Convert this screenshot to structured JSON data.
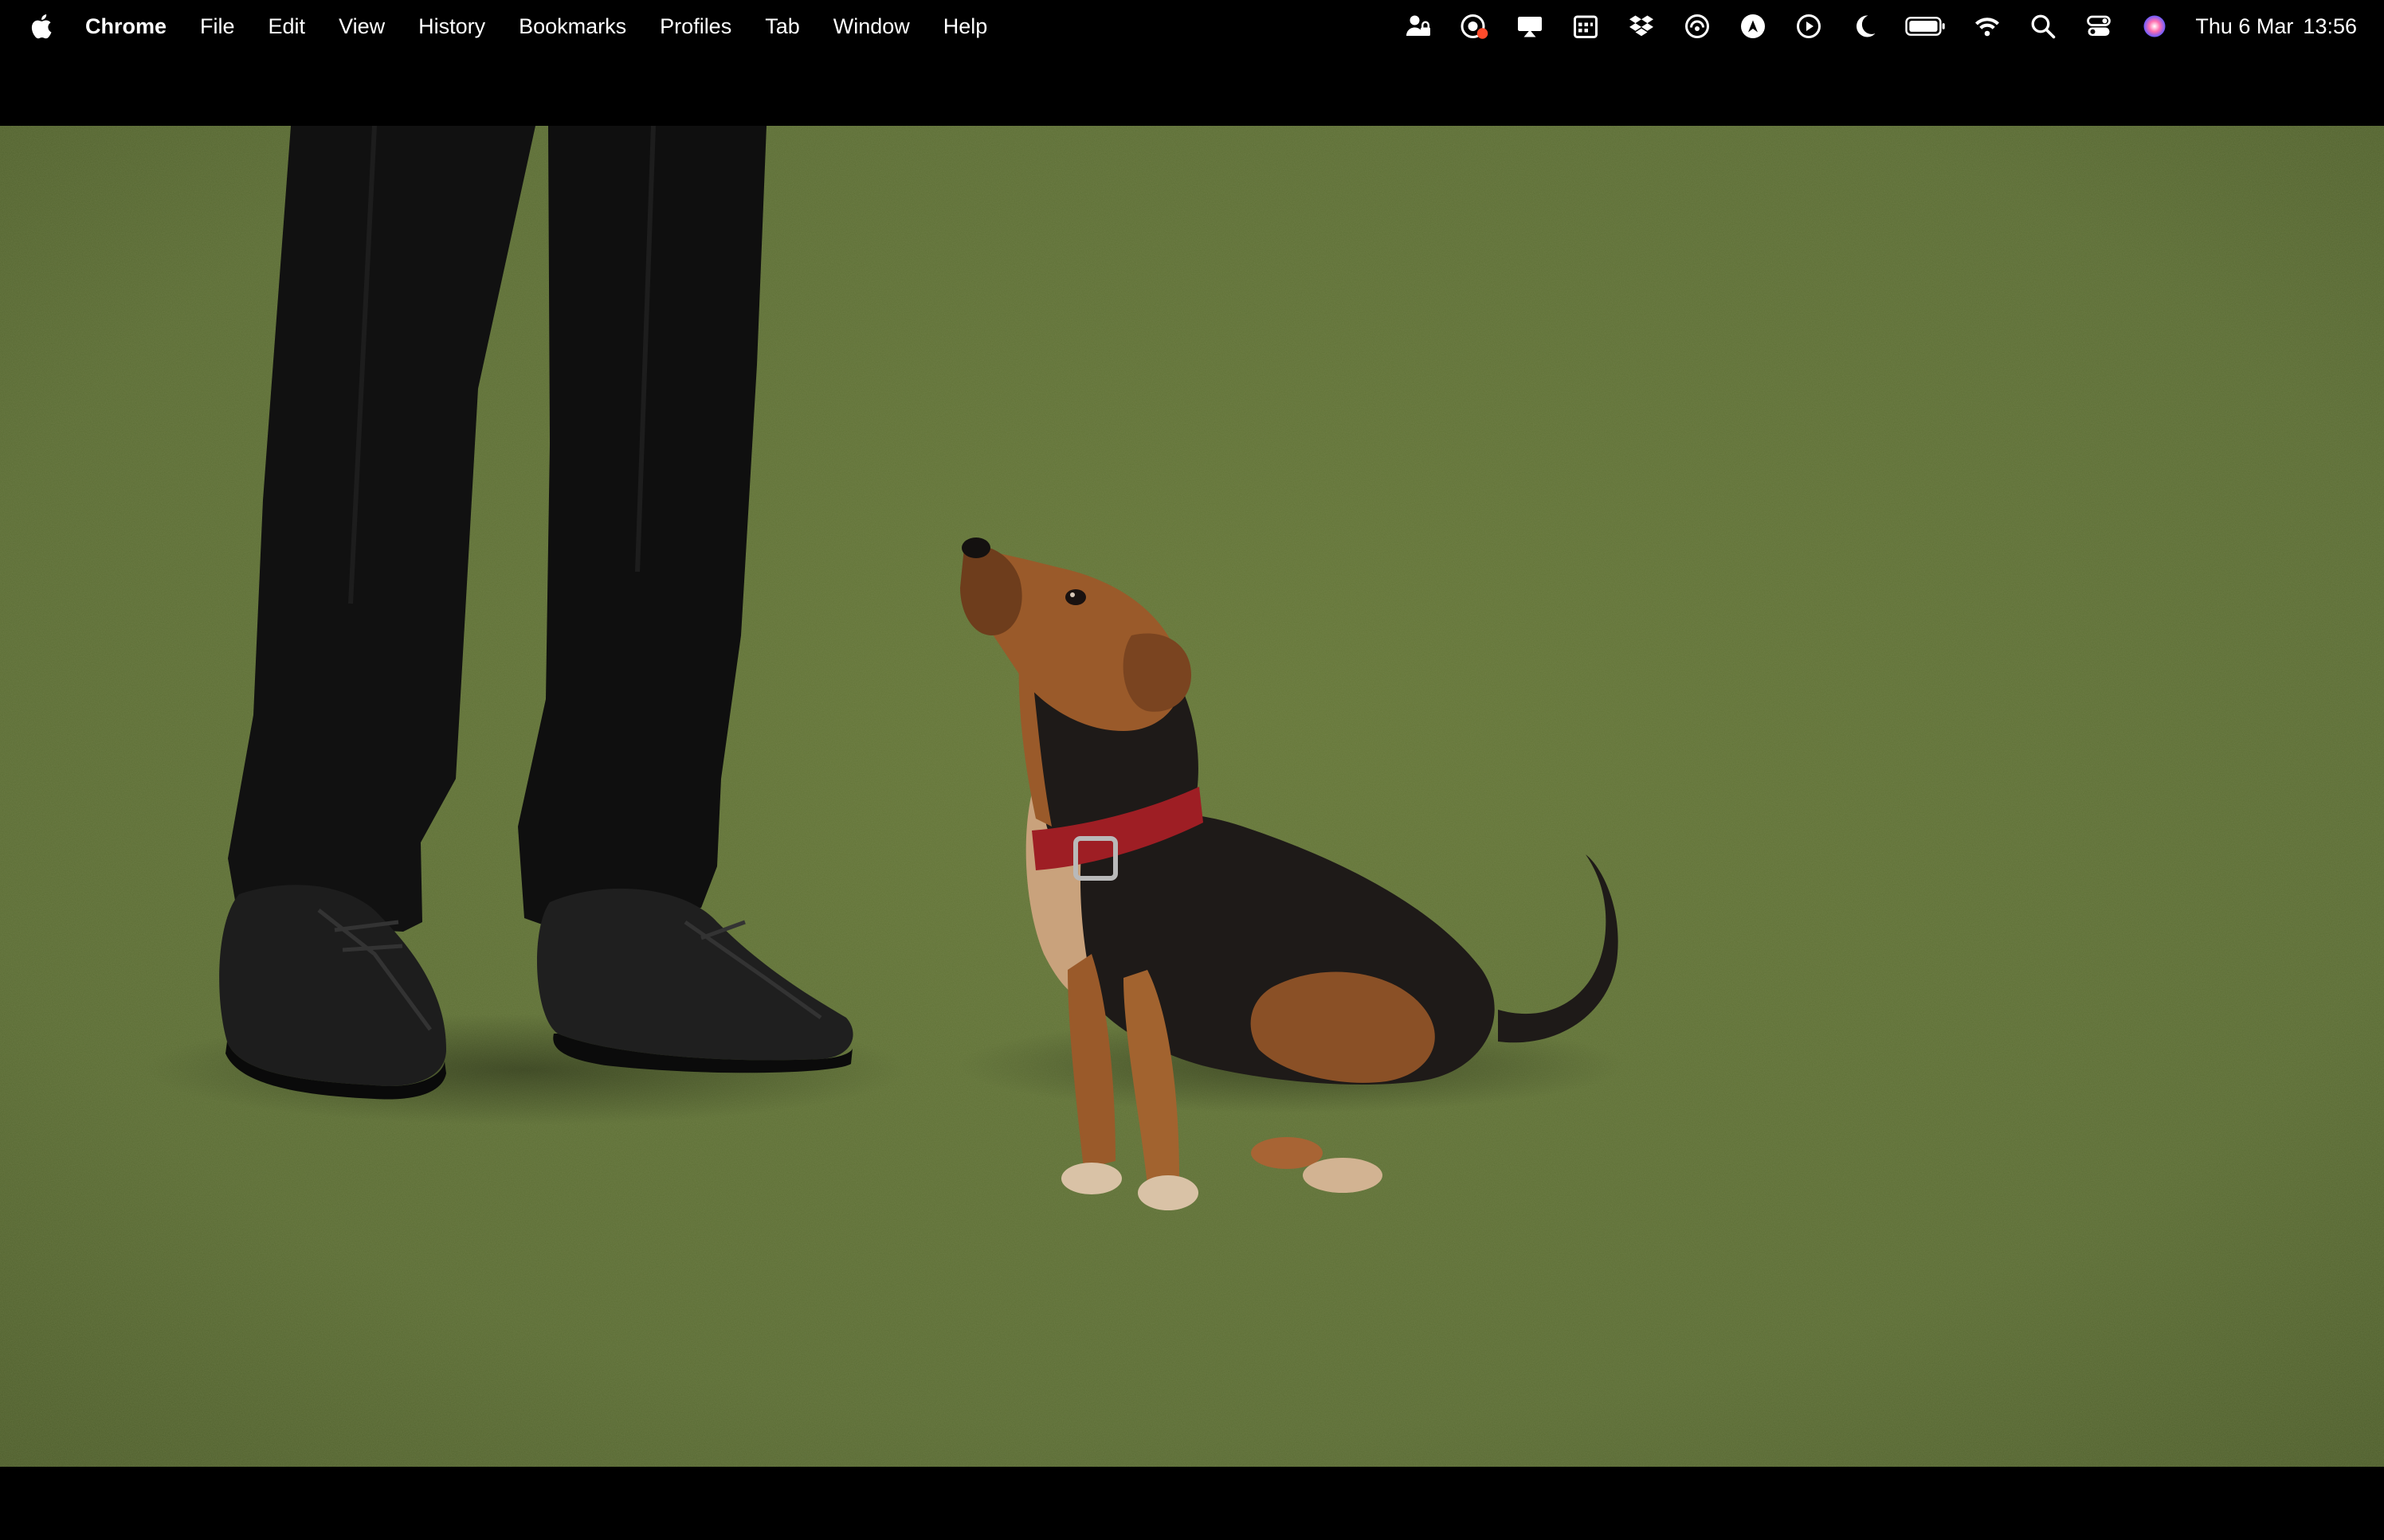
{
  "menubar": {
    "apple_icon": "apple-logo-icon",
    "app_name": "Chrome",
    "menus": [
      "File",
      "Edit",
      "View",
      "History",
      "Bookmarks",
      "Profiles",
      "Tab",
      "Window",
      "Help"
    ],
    "status_icons": [
      "lock-person-icon",
      "screen-recorder-icon",
      "airplay-display-icon",
      "calendar-grid-icon",
      "dropbox-icon",
      "edge-swirl-icon",
      "vpn-shield-icon",
      "play-circle-icon",
      "moon-icon",
      "battery-icon",
      "wifi-icon",
      "search-icon",
      "control-center-icon",
      "siri-icon"
    ],
    "date": "Thu 6 Mar",
    "time": "13:56"
  },
  "video": {
    "colors": {
      "turf": "#5b6d35",
      "trousers": "#101010",
      "shoes": "#1c1c1c",
      "dog_black": "#1e1a18",
      "dog_tan": "#9a5a2a",
      "collar": "#9e1e24"
    }
  }
}
